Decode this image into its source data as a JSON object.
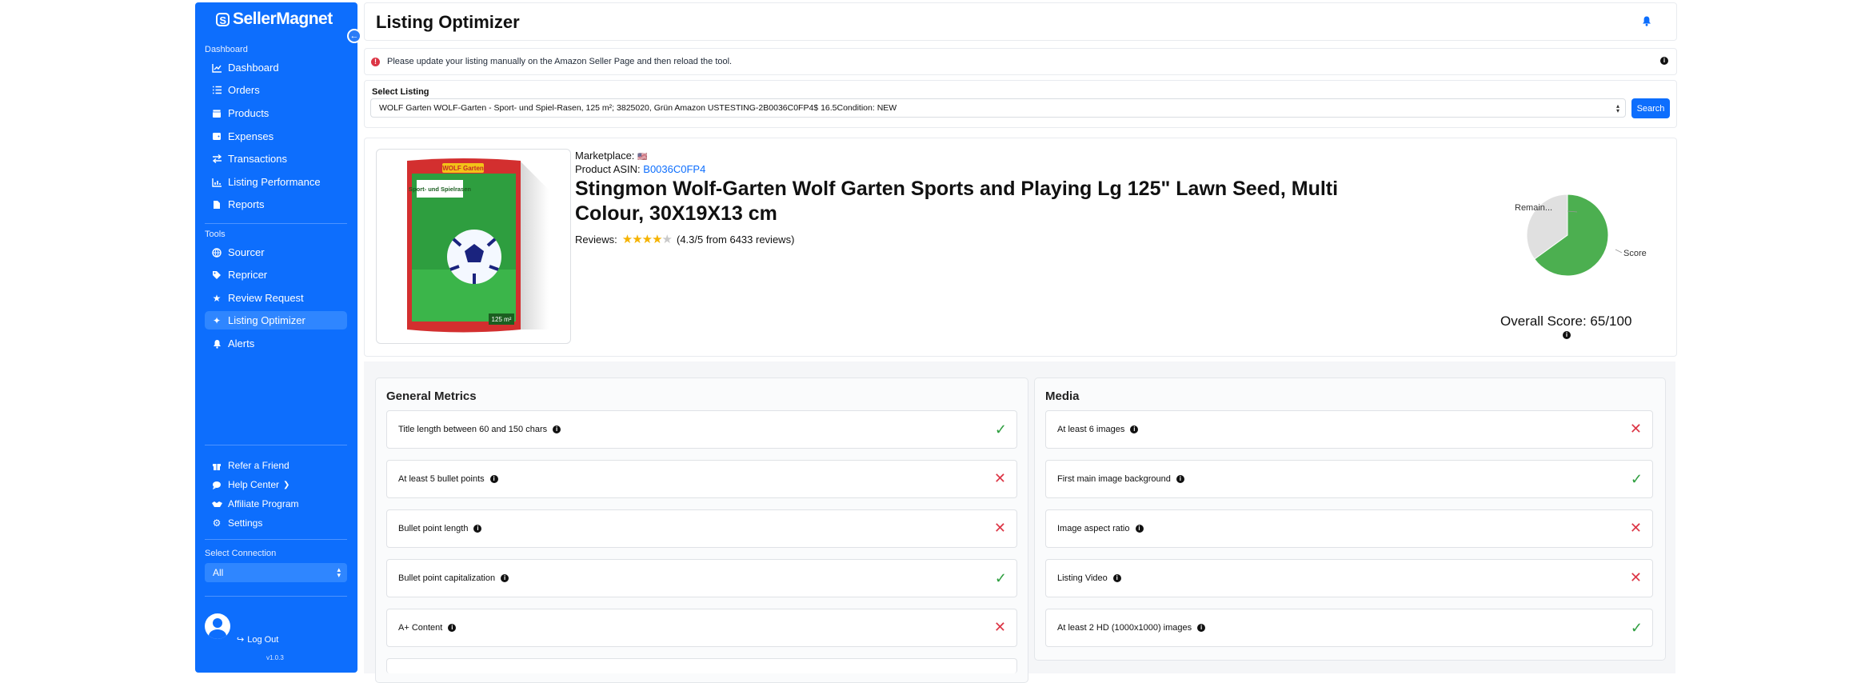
{
  "sidebar": {
    "logo": "SellerMagnet",
    "sections": {
      "dashboard": "Dashboard",
      "tools": "Tools",
      "connection": "Select Connection"
    },
    "nav": [
      {
        "label": "Dashboard",
        "icon": "chart-line-icon"
      },
      {
        "label": "Orders",
        "icon": "list-icon"
      },
      {
        "label": "Products",
        "icon": "box-icon"
      },
      {
        "label": "Expenses",
        "icon": "wallet-icon"
      },
      {
        "label": "Transactions",
        "icon": "arrows-exchange-icon"
      },
      {
        "label": "Listing Performance",
        "icon": "bar-chart-icon"
      },
      {
        "label": "Reports",
        "icon": "file-icon"
      }
    ],
    "tools": [
      {
        "label": "Sourcer",
        "icon": "globe-icon"
      },
      {
        "label": "Repricer",
        "icon": "tag-icon"
      },
      {
        "label": "Review Request",
        "icon": "star-icon"
      },
      {
        "label": "Listing Optimizer",
        "icon": "sparkles-icon",
        "active": true
      },
      {
        "label": "Alerts",
        "icon": "bell-icon"
      }
    ],
    "footer_links": [
      {
        "label": "Refer a Friend",
        "icon": "gift-icon"
      },
      {
        "label": "Help Center",
        "icon": "chat-icon"
      },
      {
        "label": "Affiliate Program",
        "icon": "handshake-icon"
      },
      {
        "label": "Settings",
        "icon": "gear-icon"
      }
    ],
    "connection_value": "All",
    "logout": "Log Out",
    "version": "v1.0.3"
  },
  "header": {
    "title": "Listing Optimizer"
  },
  "alert": {
    "message": "Please update your listing manually on the Amazon Seller Page and then reload the tool."
  },
  "listing": {
    "label": "Select Listing",
    "value": "WOLF Garten WOLF-Garten - Sport- und Spiel-Rasen, 125 m²; 3825020, Grün Amazon USTESTING-2B0036C0FP4$ 16.5Condition: NEW",
    "search_label": "Search"
  },
  "product": {
    "marketplace_label": "Marketplace:",
    "marketplace_flag": "🇺🇸",
    "asin_label": "Product ASIN:",
    "asin": "B0036C0FP4",
    "title": "Stingmon Wolf-Garten Wolf Garten Sports and Playing Lg 125\" Lawn Seed, Multi Colour, 30X19X13 cm",
    "reviews_label": "Reviews:",
    "rating": 4.3,
    "reviews_text": "(4.3/5 from 6433 reviews)",
    "package_text": "Sport- und Spielrasen",
    "brand_text": "WOLF Garten"
  },
  "score": {
    "overall_label": "Overall Score: 65/100",
    "chart_data": {
      "type": "pie",
      "labels": [
        "Score",
        "Remain..."
      ],
      "values": [
        65,
        35
      ],
      "colors": [
        "#4caf50",
        "#e0e0e0"
      ]
    }
  },
  "general_metrics": {
    "title": "General Metrics",
    "items": [
      {
        "label": "Title length between 60 and 150 chars",
        "pass": true
      },
      {
        "label": "At least 5 bullet points",
        "pass": false
      },
      {
        "label": "Bullet point length",
        "pass": false
      },
      {
        "label": "Bullet point capitalization",
        "pass": true
      },
      {
        "label": "A+ Content",
        "pass": false
      }
    ]
  },
  "media": {
    "title": "Media",
    "items": [
      {
        "label": "At least 6 images",
        "pass": false
      },
      {
        "label": "First main image background",
        "pass": true
      },
      {
        "label": "Image aspect ratio",
        "pass": false
      },
      {
        "label": "Listing Video",
        "pass": false
      },
      {
        "label": "At least 2 HD (1000x1000) images",
        "pass": true
      }
    ]
  }
}
